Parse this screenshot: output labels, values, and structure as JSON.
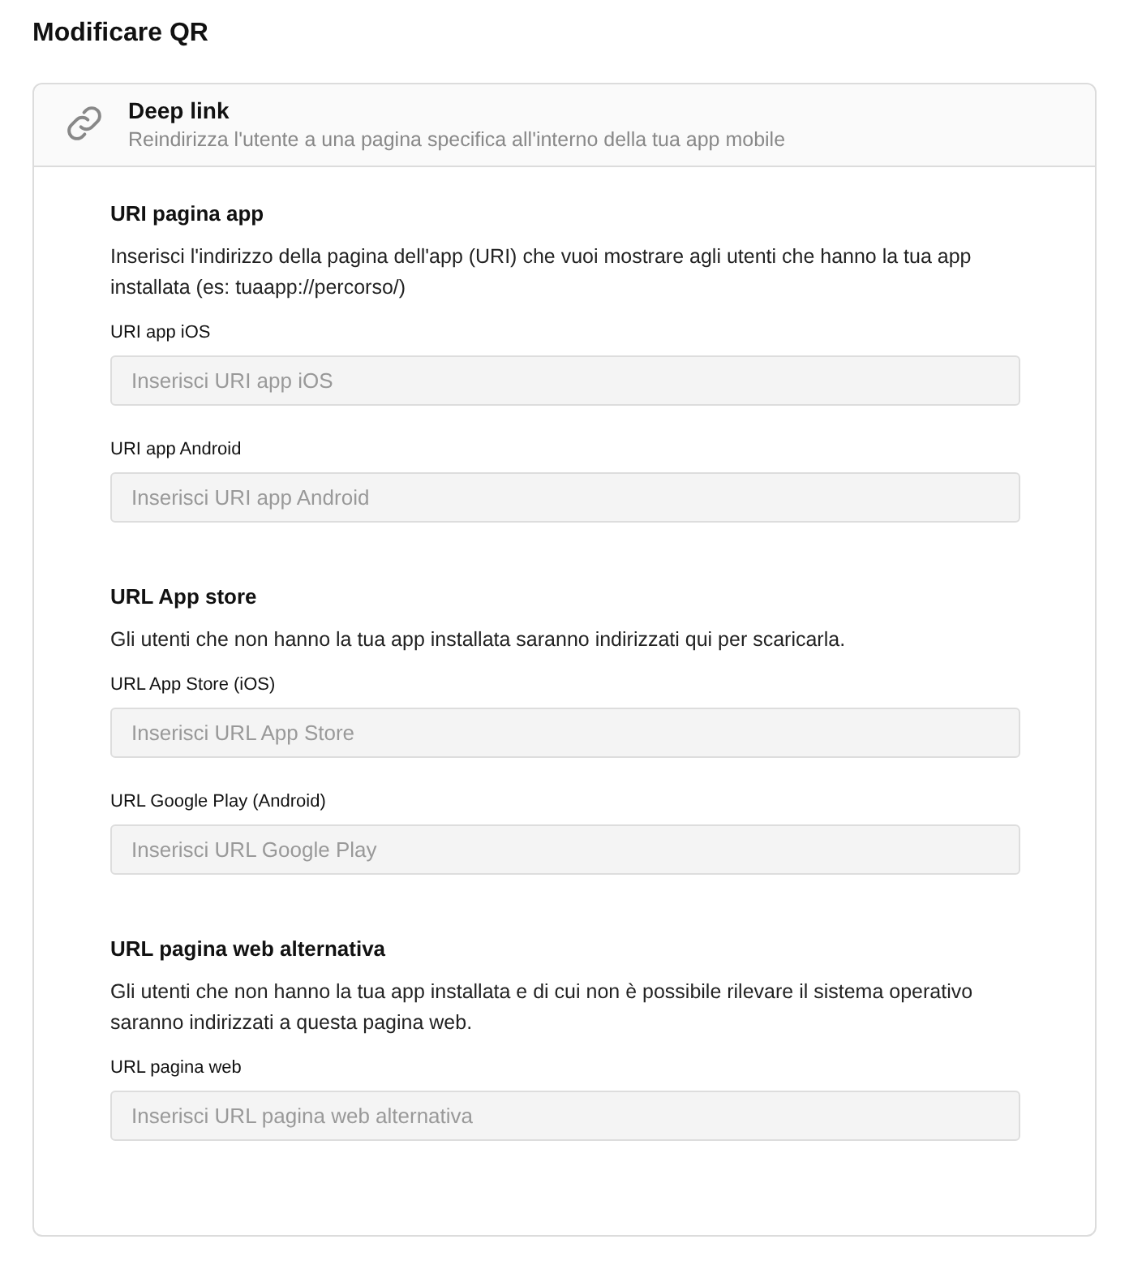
{
  "page_title": "Modificare QR",
  "card": {
    "title": "Deep link",
    "subtitle": "Reindirizza l'utente a una pagina specifica all'interno della tua app mobile"
  },
  "sections": [
    {
      "heading": "URI pagina app",
      "description": "Inserisci l'indirizzo della pagina dell'app (URI) che vuoi mostrare agli utenti che hanno la tua app installata (es: tuaapp://percorso/)",
      "fields": [
        {
          "label": "URI app iOS",
          "placeholder": "Inserisci URI app iOS"
        },
        {
          "label": "URI app Android",
          "placeholder": "Inserisci URI app Android"
        }
      ]
    },
    {
      "heading": "URL App store",
      "description": "Gli utenti che non hanno la tua app installata saranno indirizzati qui per scaricarla.",
      "fields": [
        {
          "label": "URL App Store (iOS)",
          "placeholder": "Inserisci URL App Store"
        },
        {
          "label": "URL Google Play (Android)",
          "placeholder": "Inserisci URL Google Play"
        }
      ]
    },
    {
      "heading": "URL pagina web alternativa",
      "description": "Gli utenti che non hanno la tua app installata e di cui non è possibile rilevare il sistema operativo saranno indirizzati a questa pagina web.",
      "fields": [
        {
          "label": "URL pagina web",
          "placeholder": "Inserisci URL pagina web alternativa"
        }
      ]
    }
  ]
}
